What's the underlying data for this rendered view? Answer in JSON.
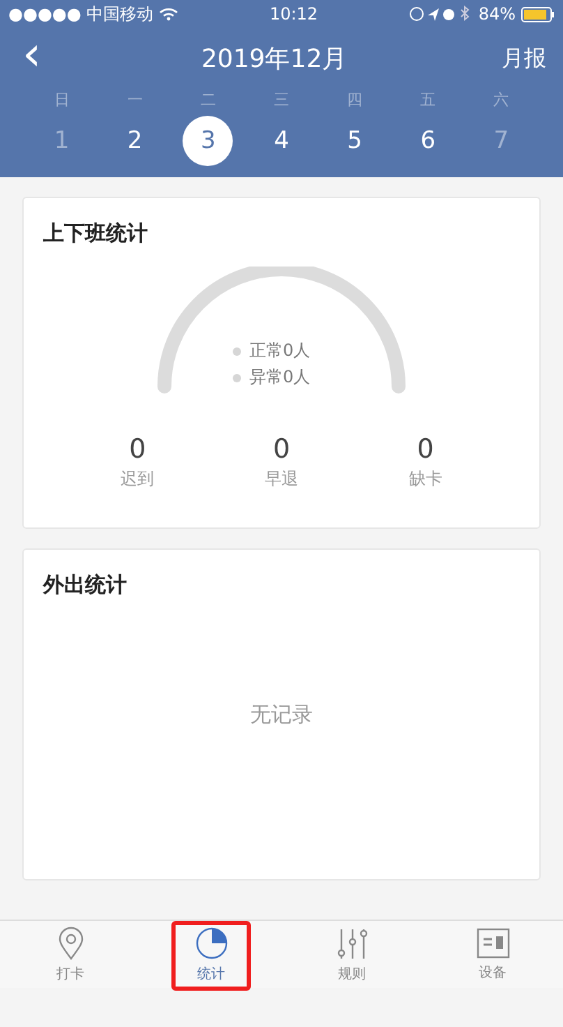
{
  "status_bar": {
    "carrier": "●●●●● 中国移动",
    "time": "10:12",
    "battery": "84%"
  },
  "nav": {
    "back": "‹",
    "title": "2019年12月",
    "action": "月报"
  },
  "week": [
    {
      "weekday": "日",
      "day": "1",
      "selected": false,
      "dimmed": true
    },
    {
      "weekday": "一",
      "day": "2",
      "selected": false,
      "dimmed": false
    },
    {
      "weekday": "二",
      "day": "3",
      "selected": true,
      "dimmed": false
    },
    {
      "weekday": "三",
      "day": "4",
      "selected": false,
      "dimmed": false
    },
    {
      "weekday": "四",
      "day": "5",
      "selected": false,
      "dimmed": false
    },
    {
      "weekday": "五",
      "day": "6",
      "selected": false,
      "dimmed": false
    },
    {
      "weekday": "六",
      "day": "7",
      "selected": false,
      "dimmed": true
    }
  ],
  "attendance": {
    "title": "上下班统计",
    "legend": [
      "正常0人",
      "异常0人"
    ],
    "stats": [
      {
        "value": "0",
        "label": "迟到"
      },
      {
        "value": "0",
        "label": "早退"
      },
      {
        "value": "0",
        "label": "缺卡"
      }
    ]
  },
  "outings": {
    "title": "外出统计",
    "empty": "无记录"
  },
  "tabs": [
    {
      "kind": "pin",
      "label": "打卡",
      "selected": false,
      "highlighted": false
    },
    {
      "kind": "pie",
      "label": "统计",
      "selected": true,
      "highlighted": true
    },
    {
      "kind": "sliders",
      "label": "规则",
      "selected": false,
      "highlighted": false
    },
    {
      "kind": "device",
      "label": "设备",
      "selected": false,
      "highlighted": false
    }
  ]
}
